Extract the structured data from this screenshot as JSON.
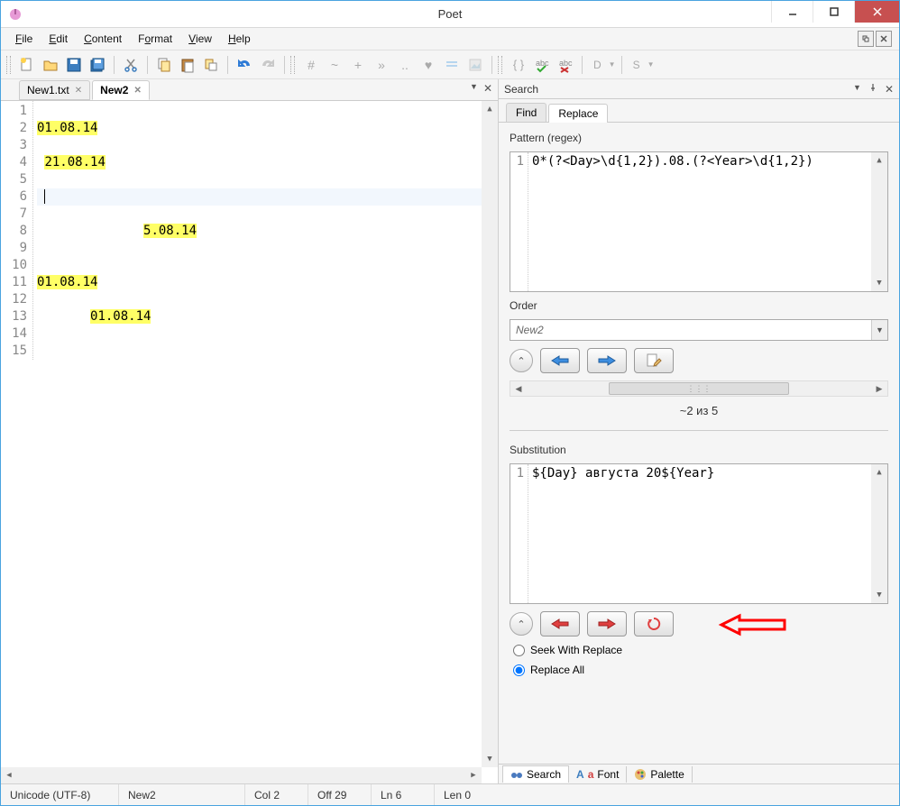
{
  "window": {
    "title": "Poet"
  },
  "menu": {
    "file": "File",
    "edit": "Edit",
    "content": "Content",
    "format": "Format",
    "view": "View",
    "help": "Help"
  },
  "toolbar": {
    "drop1": "D",
    "drop2": "S"
  },
  "editor": {
    "tabs": [
      {
        "label": "New1.txt",
        "active": false
      },
      {
        "label": "New2",
        "active": true
      }
    ],
    "lines": [
      "",
      "01.08.14",
      "",
      " 21.08.14",
      "",
      " ",
      "",
      "              5.08.14",
      "",
      "",
      "01.08.14",
      "",
      "       01.08.14",
      "",
      ""
    ],
    "highlights": {
      "2": "01.08.14",
      "4": "21.08.14",
      "8": "5.08.14",
      "11": "01.08.14",
      "13": "01.08.14"
    },
    "cursor_line": 6
  },
  "search": {
    "title": "Search",
    "tabs": {
      "find": "Find",
      "replace": "Replace"
    },
    "pattern_label": "Pattern (regex)",
    "pattern_value": "0*(?<Day>\\d{1,2}).08.(?<Year>\\d{1,2})",
    "order_label": "Order",
    "order_value": "New2",
    "count_text": "~2 из 5",
    "substitution_label": "Substitution",
    "substitution_value": "${Day} августа 20${Year}",
    "seek_label": "Seek With Replace",
    "replace_all_label": "Replace All"
  },
  "bottom_tabs": {
    "search": "Search",
    "font": "Font",
    "palette": "Palette"
  },
  "status": {
    "encoding": "Unicode (UTF-8)",
    "doc": "New2",
    "col": "Col 2",
    "off": "Off 29",
    "ln": "Ln 6",
    "len": "Len 0"
  }
}
